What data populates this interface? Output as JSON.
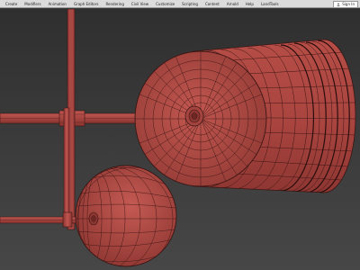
{
  "menu": {
    "items": [
      "Create",
      "Modifiers",
      "Animation",
      "Graph Editors",
      "Rendering",
      "Civil View",
      "Customize",
      "Scripting",
      "Content",
      "Arnold",
      "Help",
      "LandTools"
    ],
    "sign_in": "Sign In"
  },
  "colors": {
    "mesh_fill": "#b04a45",
    "mesh_wire": "#3c1614",
    "viewport_bg_top": "#2f2f2f",
    "viewport_bg_bottom": "#474747",
    "menubar_bg": "#dcdcdc"
  },
  "icons": {
    "user": "user-icon"
  }
}
